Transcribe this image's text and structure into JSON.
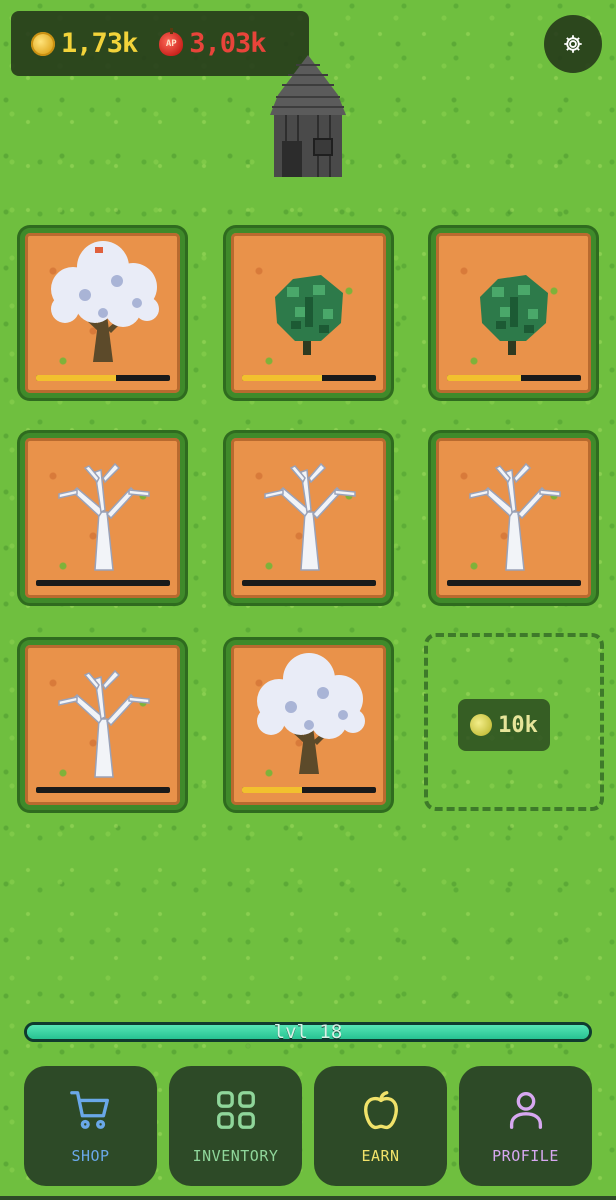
{
  "hud": {
    "coins": "1,73k",
    "coin_icon": "gold-coin-icon",
    "ap": "3,03k",
    "ap_icon": "ap-apple-icon",
    "ap_badge": "AP"
  },
  "settings": {
    "icon": "gear-icon"
  },
  "plots": [
    {
      "tree": "snowy-blossom-tree",
      "progress": 0.6
    },
    {
      "tree": "green-sapling",
      "progress": 0.6
    },
    {
      "tree": "green-sapling",
      "progress": 0.55
    },
    {
      "tree": "bare-snowy-tree",
      "progress": 0
    },
    {
      "tree": "bare-snowy-tree",
      "progress": 0
    },
    {
      "tree": "bare-snowy-tree",
      "progress": 0
    },
    {
      "tree": "bare-snowy-tree",
      "progress": 0
    },
    {
      "tree": "snowy-blossom-tree",
      "progress": 0.45
    }
  ],
  "buy_plot": {
    "price": "10k",
    "icon": "coin-icon"
  },
  "level": {
    "label": "lvl 18",
    "progress": 1.0
  },
  "nav": {
    "shop": {
      "label": "SHOP",
      "icon": "cart-icon",
      "color": "#6aa8e8"
    },
    "inventory": {
      "label": "INVENTORY",
      "icon": "grid-icon",
      "color": "#8fd69a"
    },
    "earn": {
      "label": "EARN",
      "icon": "apple-icon",
      "color": "#f0e26a"
    },
    "profile": {
      "label": "PROFILE",
      "icon": "user-icon",
      "color": "#d7a8f0"
    }
  },
  "colors": {
    "grass": "#6fbf3f",
    "soil": "#e9924a",
    "progress": "#f2c12e",
    "level": "#27c292",
    "panel": "#2d4a27"
  }
}
